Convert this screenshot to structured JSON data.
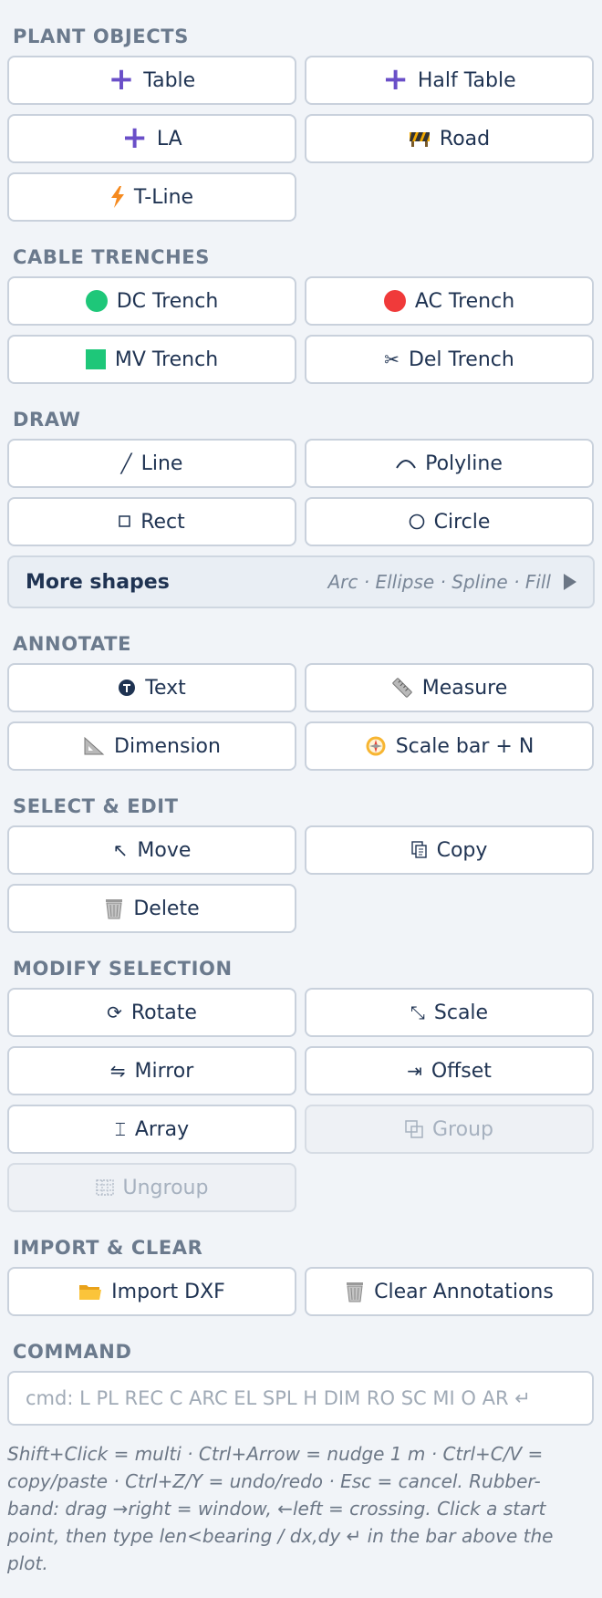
{
  "sections": {
    "plant": {
      "title": "PLANT OBJECTS",
      "buttons": [
        {
          "label": "Table",
          "icon": "plus-icon"
        },
        {
          "label": "Half Table",
          "icon": "plus-icon"
        },
        {
          "label": "LA",
          "icon": "plus-icon"
        },
        {
          "label": "Road",
          "icon": "road-barrier-icon"
        },
        {
          "label": "T-Line",
          "icon": "lightning-icon"
        }
      ]
    },
    "trenches": {
      "title": "CABLE TRENCHES",
      "buttons": [
        {
          "label": "DC Trench",
          "icon": "green-dot-icon",
          "color": "#1ec779"
        },
        {
          "label": "AC Trench",
          "icon": "red-dot-icon",
          "color": "#f03a3a"
        },
        {
          "label": "MV Trench",
          "icon": "green-square-icon",
          "color": "#1ec779"
        },
        {
          "label": "Del Trench",
          "icon": "scissors-icon"
        }
      ]
    },
    "draw": {
      "title": "DRAW",
      "buttons": [
        {
          "label": "Line",
          "icon": "line-icon"
        },
        {
          "label": "Polyline",
          "icon": "arc-icon"
        },
        {
          "label": "Rect",
          "icon": "square-icon"
        },
        {
          "label": "Circle",
          "icon": "circle-icon"
        }
      ],
      "more": {
        "label": "More shapes",
        "hint": "Arc · Ellipse · Spline · Fill"
      }
    },
    "annotate": {
      "title": "ANNOTATE",
      "buttons": [
        {
          "label": "Text",
          "icon": "text-icon"
        },
        {
          "label": "Measure",
          "icon": "ruler-icon"
        },
        {
          "label": "Dimension",
          "icon": "triangle-ruler-icon"
        },
        {
          "label": "Scale bar + N",
          "icon": "compass-icon"
        }
      ]
    },
    "select_edit": {
      "title": "SELECT & EDIT",
      "buttons": [
        {
          "label": "Move",
          "icon": "arrow-nw-icon"
        },
        {
          "label": "Copy",
          "icon": "copy-icon"
        },
        {
          "label": "Delete",
          "icon": "trash-icon"
        }
      ]
    },
    "modify": {
      "title": "MODIFY SELECTION",
      "buttons": [
        {
          "label": "Rotate",
          "icon": "rotate-icon"
        },
        {
          "label": "Scale",
          "icon": "scale-icon"
        },
        {
          "label": "Mirror",
          "icon": "mirror-icon"
        },
        {
          "label": "Offset",
          "icon": "offset-icon"
        },
        {
          "label": "Array",
          "icon": "array-icon"
        },
        {
          "label": "Group",
          "icon": "group-icon",
          "disabled": true
        },
        {
          "label": "Ungroup",
          "icon": "ungroup-icon",
          "disabled": true
        }
      ]
    },
    "import_clear": {
      "title": "IMPORT & CLEAR",
      "buttons": [
        {
          "label": "Import DXF",
          "icon": "folder-icon"
        },
        {
          "label": "Clear Annotations",
          "icon": "trash-icon"
        }
      ]
    },
    "command": {
      "title": "COMMAND",
      "placeholder": "cmd: L PL REC C ARC EL SPL H DIM RO SC MI O AR  ↵"
    }
  },
  "help_text": "Shift+Click = multi · Ctrl+Arrow = nudge 1 m · Ctrl+C/V = copy/paste · Ctrl+Z/Y = undo/redo · Esc = cancel. Rubber-band: drag →right = window, ←left = crossing. Click a start point, then type len<bearing / dx,dy ↵ in the bar above the plot."
}
